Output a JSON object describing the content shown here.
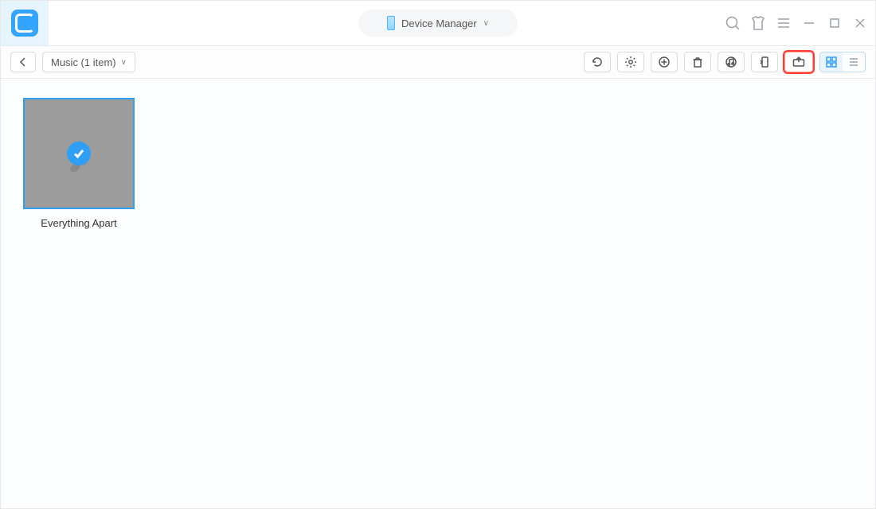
{
  "header": {
    "device_label": "Device Manager"
  },
  "toolbar": {
    "breadcrumb_label": "Music (1 item)"
  },
  "content": {
    "items": [
      {
        "title": "Everything Apart",
        "selected": true
      }
    ]
  }
}
